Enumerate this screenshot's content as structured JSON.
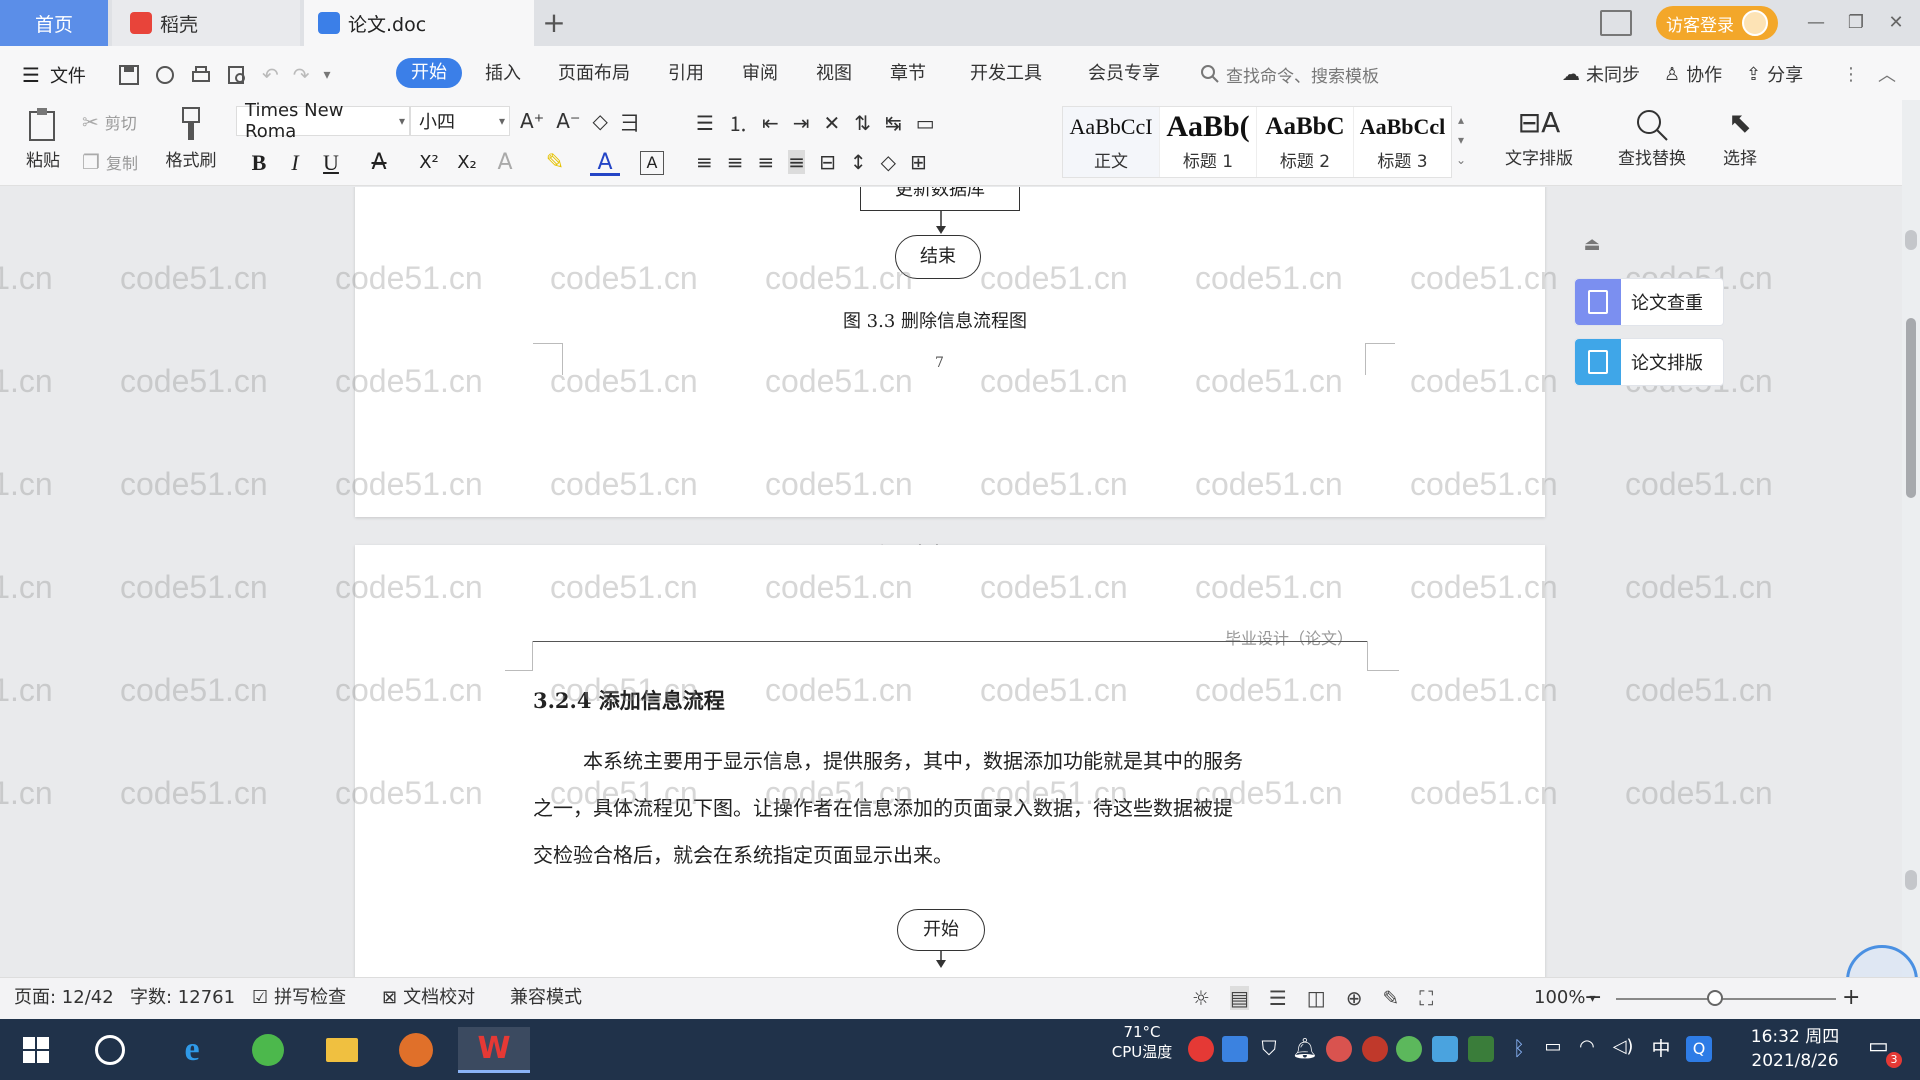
{
  "titlebar": {
    "tab_home": "首页",
    "tab_daoke": "稻壳",
    "tab_doc": "论文.doc",
    "add_tab": "+",
    "login": "访客登录"
  },
  "menu": {
    "file": "文件",
    "items": [
      "开始",
      "插入",
      "页面布局",
      "引用",
      "审阅",
      "视图",
      "章节",
      "开发工具",
      "会员专享"
    ],
    "search_placeholder": "查找命令、搜索模板",
    "sync": "未同步",
    "collab": "协作",
    "share": "分享"
  },
  "ribbon": {
    "paste": "粘贴",
    "cut": "剪切",
    "copy": "复制",
    "format_painter": "格式刷",
    "font_name": "Times New Roma",
    "font_size": "小四",
    "styles": [
      {
        "sample": "AaBbCcI",
        "name": "正文"
      },
      {
        "sample": "AaBb(",
        "name": "标题 1"
      },
      {
        "sample": "AaBbC",
        "name": "标题 2"
      },
      {
        "sample": "AaBbCcl",
        "name": "标题 3"
      }
    ],
    "text_layout": "文字排版",
    "find_replace": "查找替换",
    "select": "选择"
  },
  "document": {
    "flow_box_update": "更新数据库",
    "flow_end": "结束",
    "figure_caption": "图 3.3  删除信息流程图",
    "page_number": "7",
    "between_pages": "源码久久-code99.top",
    "header_text": "毕业设计（论文）",
    "section_heading": "3.2.4  添加信息流程",
    "para_line1": "本系统主要用于显示信息，提供服务，其中，数据添加功能就是其中的服务",
    "para_line2": "之一，具体流程见下图。让操作者在信息添加的页面录入数据，待这些数据被提",
    "para_line3": "交检验合格后，就会在系统指定页面显示出来。",
    "flow_start": "开始",
    "watermark": "code51.cn"
  },
  "side_panel": {
    "check": "论文查重",
    "format": "论文排版"
  },
  "status": {
    "page": "页面: 12/42",
    "words": "字数: 12761",
    "spell": "拼写检查",
    "proof": "文档校对",
    "compat": "兼容模式",
    "zoom": "100%",
    "zoom_level": 0.45
  },
  "taskbar": {
    "temp": "71°C",
    "temp_label": "CPU温度",
    "ime": "中",
    "time": "16:32 周四",
    "date": "2021/8/26",
    "notif_count": "3"
  },
  "colors": {
    "accent": "#3b7fe8",
    "home_tab": "#5b8ee8",
    "login": "#f3a72a",
    "taskbar": "#20324a"
  }
}
